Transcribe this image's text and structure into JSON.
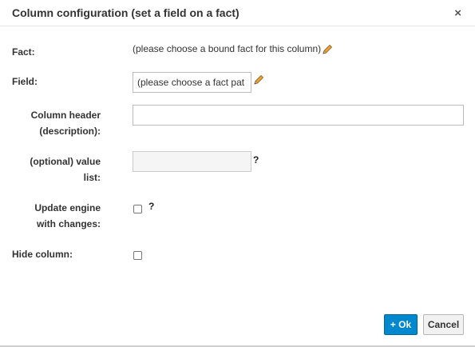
{
  "dialog": {
    "title": "Column configuration (set a field on a fact)",
    "close_symbol": "×"
  },
  "form": {
    "fact": {
      "label": "Fact:",
      "value": "(please choose a bound fact for this column)",
      "edit_icon": "pencil-icon"
    },
    "field": {
      "label": "Field:",
      "value": "(please choose a fact pat",
      "edit_icon": "pencil-icon"
    },
    "column_header": {
      "label_line1": "Column header",
      "label_line2": "(description):",
      "value": ""
    },
    "value_list": {
      "label_line1": "(optional) value",
      "label_line2": "list:",
      "help": "?"
    },
    "update_engine": {
      "label_line1": "Update engine",
      "label_line2": "with changes:",
      "help": "?",
      "checked": false
    },
    "hide_column": {
      "label": "Hide column:",
      "checked": false
    }
  },
  "footer": {
    "ok_label": "+ Ok",
    "cancel_label": "Cancel"
  },
  "colors": {
    "primary_button": "#0088ce",
    "pencil": "#e8a33a"
  }
}
